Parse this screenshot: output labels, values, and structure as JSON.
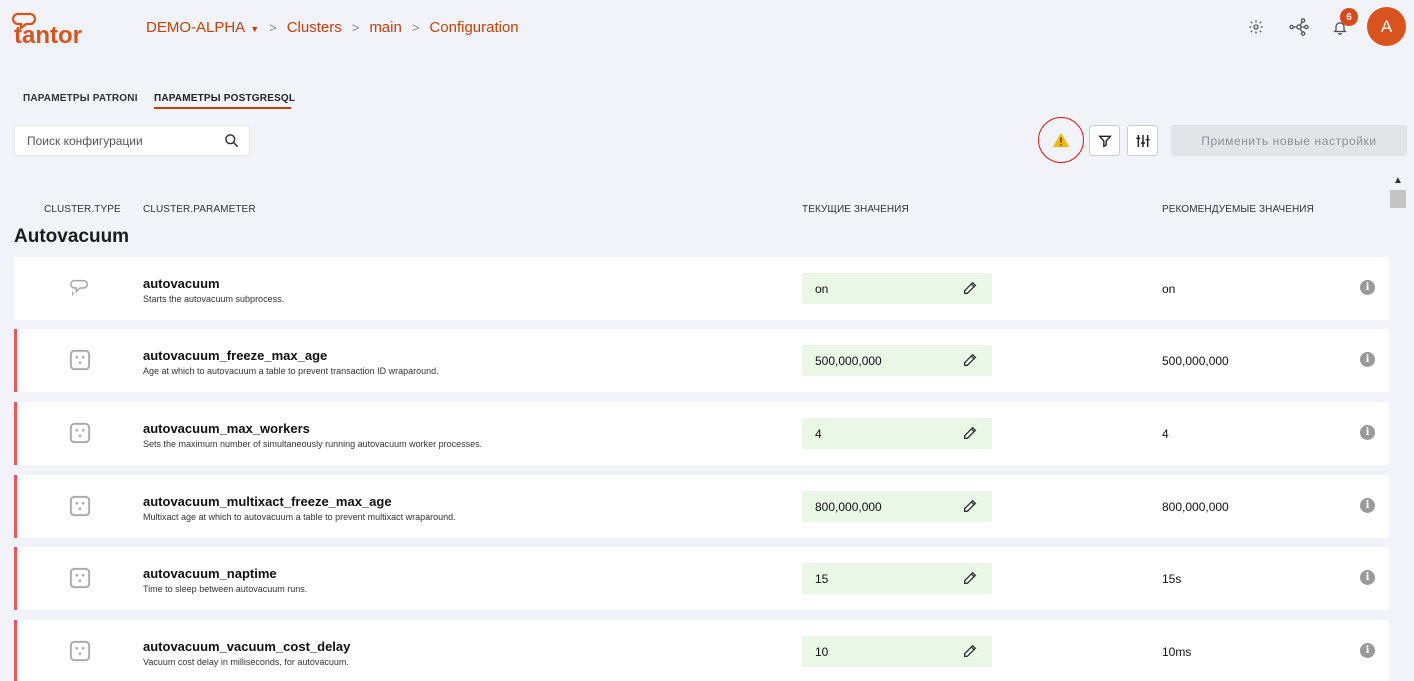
{
  "header": {
    "logo_text": "tantor",
    "breadcrumb": [
      {
        "label": "DEMO-ALPHA",
        "has_dropdown": true
      },
      {
        "label": "Clusters"
      },
      {
        "label": "main"
      },
      {
        "label": "Configuration"
      }
    ],
    "notifications_count": "6",
    "avatar_initial": "A",
    "icons": [
      "gear-icon",
      "network-icon",
      "bell-icon"
    ]
  },
  "tabs": [
    {
      "label": "ПАРАМЕТРЫ PATRONI",
      "active": false
    },
    {
      "label": "ПАРАМЕТРЫ POSTGRESQL",
      "active": true
    }
  ],
  "search": {
    "placeholder": "Поиск конфигурации",
    "value": ""
  },
  "toolbar": {
    "warning_icon": "warning-triangle-icon",
    "filter_icon": "filter-icon",
    "settings_icon": "sliders-icon",
    "apply_label": "Применить новые настройки"
  },
  "columns": {
    "type": "CLUSTER.TYPE",
    "parameter": "CLUSTER.PARAMETER",
    "current": "ТЕКУЩИЕ ЗНАЧЕНИЯ",
    "recommended": "РЕКОМЕНДУЕМЫЕ ЗНАЧЕНИЯ"
  },
  "section": {
    "title": "Autovacuum"
  },
  "rows": [
    {
      "name": "autovacuum",
      "description": "Starts the autovacuum subprocess.",
      "current": "on",
      "recommended": "on",
      "flagged": false,
      "type_icon": "patroni-icon"
    },
    {
      "name": "autovacuum_freeze_max_age",
      "description": "Age at which to autovacuum a table to prevent transaction ID wraparound.",
      "current": "500,000,000",
      "recommended": "500,000,000",
      "flagged": true,
      "type_icon": "dice-icon"
    },
    {
      "name": "autovacuum_max_workers",
      "description": "Sets the maximum number of simultaneously running autovacuum worker processes.",
      "current": "4",
      "recommended": "4",
      "flagged": true,
      "type_icon": "dice-icon"
    },
    {
      "name": "autovacuum_multixact_freeze_max_age",
      "description": "Multixact age at which to autovacuum a table to prevent multixact wraparound.",
      "current": "800,000,000",
      "recommended": "800,000,000",
      "flagged": true,
      "type_icon": "dice-icon"
    },
    {
      "name": "autovacuum_naptime",
      "description": "Time to sleep between autovacuum runs.",
      "current": "15",
      "recommended": "15s",
      "flagged": true,
      "type_icon": "dice-icon"
    },
    {
      "name": "autovacuum_vacuum_cost_delay",
      "description": "Vacuum cost delay in milliseconds, for autovacuum.",
      "current": "10",
      "recommended": "10ms",
      "flagged": true,
      "type_icon": "dice-icon"
    }
  ],
  "colors": {
    "accent": "#c2410c",
    "flag": "#e45b5b",
    "value_bg": "#eaf6e6",
    "warning": "#f5b800"
  }
}
